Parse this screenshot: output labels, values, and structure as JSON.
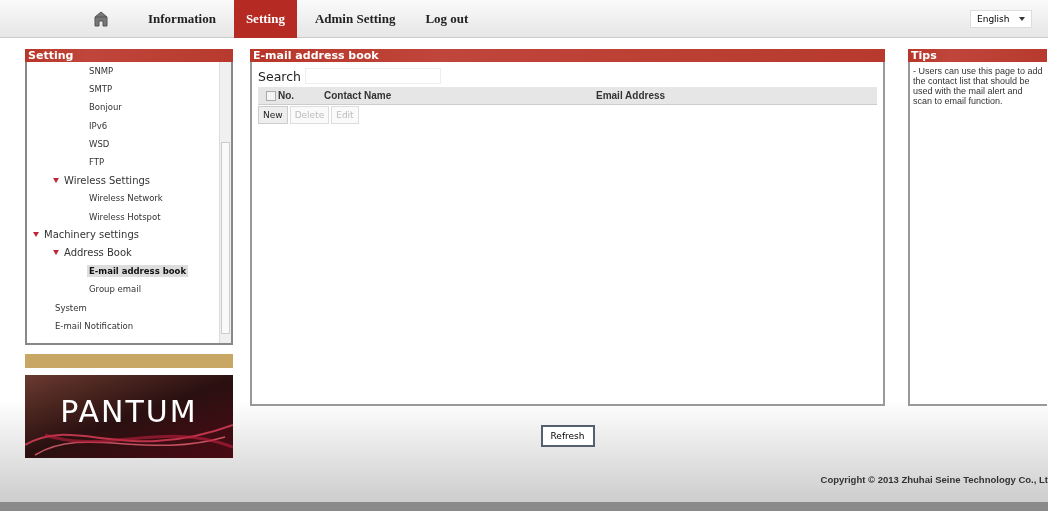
{
  "nav": {
    "tabs": [
      {
        "label": "Information",
        "selected": false
      },
      {
        "label": "Setting",
        "selected": true
      },
      {
        "label": "Admin Setting",
        "selected": false
      },
      {
        "label": "Log out",
        "selected": false
      }
    ],
    "language": "English"
  },
  "sidebar": {
    "title": "Setting",
    "tree": [
      {
        "children": [
          {
            "children": [
              {
                "label": "SNMP",
                "selected": false
              },
              {
                "label": "SMTP",
                "selected": false
              },
              {
                "label": "Bonjour",
                "selected": false
              },
              {
                "label": "IPv6",
                "selected": false
              },
              {
                "label": "WSD",
                "selected": false
              },
              {
                "label": "FTP",
                "selected": false
              }
            ]
          },
          {
            "label": "Wireless Settings",
            "expanded": true,
            "children": [
              {
                "label": "Wireless Network",
                "selected": false
              },
              {
                "label": "Wireless Hotspot",
                "selected": false
              }
            ]
          }
        ]
      },
      {
        "label": "Machinery settings",
        "expanded": true,
        "children": [
          {
            "label": "Address Book",
            "expanded": true,
            "children": [
              {
                "label": "E-mail address book",
                "selected": true
              },
              {
                "label": "Group email",
                "selected": false
              }
            ]
          },
          {
            "label": "System",
            "selected": false
          },
          {
            "label": "E-mail Notification",
            "selected": false
          }
        ]
      }
    ]
  },
  "logo": {
    "text": "PANTUM"
  },
  "main": {
    "title": "E-mail address book",
    "search_label": "Search",
    "select_all": {
      "checked": false
    },
    "columns": [
      "No.",
      "Contact Name",
      "Email Address"
    ],
    "buttons": [
      {
        "label": "New",
        "disabled": false
      },
      {
        "label": "Delete",
        "disabled": true
      },
      {
        "label": "Edit",
        "disabled": true
      }
    ]
  },
  "tips": {
    "title": "Tips",
    "text": "- Users can use this page to add the contact list that should be used with the mail alert and scan to email function."
  },
  "refresh_button": "Refresh",
  "copyright": "Copyright © 2013 Zhuhai Seine Technology Co., Lt"
}
